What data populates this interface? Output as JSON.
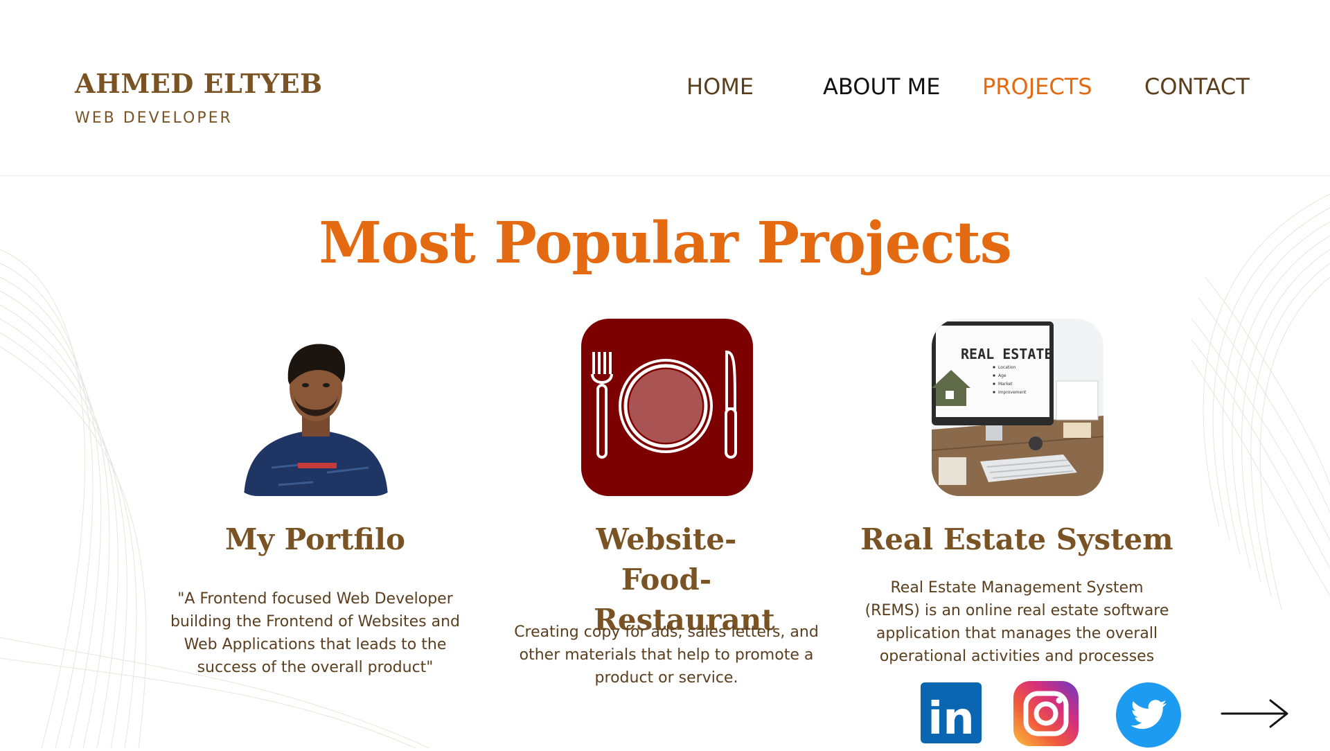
{
  "brand": {
    "name": "AHMED ELTYEB",
    "role": "WEB DEVELOPER"
  },
  "nav": {
    "items": [
      {
        "label": "HOME",
        "color": "#5b3e1e"
      },
      {
        "label": "ABOUT ME",
        "color": "#111111"
      },
      {
        "label": "PROJECTS",
        "color": "#e36a10",
        "active": true
      },
      {
        "label": "CONTACT",
        "color": "#5b3e1e"
      }
    ]
  },
  "main": {
    "title": "Most Popular Projects",
    "projects": [
      {
        "title": "My Portfilo",
        "description": "\"A Frontend focused Web Developer building the Frontend of Websites and Web Applications that leads to the success of the overall product\"",
        "icon": "portrait-photo"
      },
      {
        "title": "Website-Food-Restaurant",
        "description": "Creating copy for ads, sales letters, and other materials that help to promote a product or service.",
        "icon": "plate-fork-knife-icon"
      },
      {
        "title": "Real Estate System",
        "description": "Real Estate Management System (REMS) is an online real estate software application that manages the overall operational activities and processes",
        "icon": "real-estate-monitor-photo",
        "screen_text": "REAL ESTATE",
        "screen_list": [
          "Location",
          "Age",
          "Market",
          "Improvement"
        ]
      }
    ]
  },
  "social": {
    "linkedin_text": "in",
    "items": [
      "linkedin-icon",
      "instagram-icon",
      "twitter-icon"
    ]
  },
  "colors": {
    "accent": "#e36a10",
    "brand": "#7a5325",
    "food_bg": "#7d0000"
  }
}
